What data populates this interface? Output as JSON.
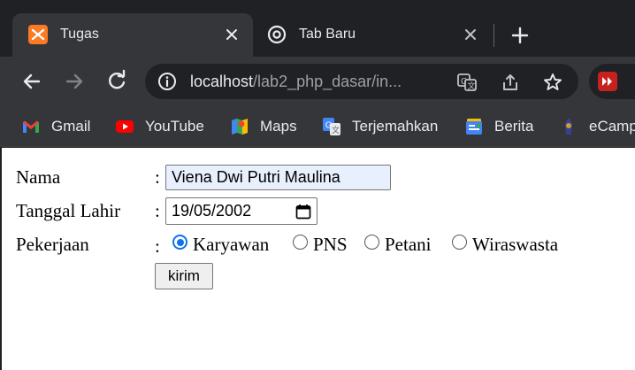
{
  "tabs": [
    {
      "title": "Tugas",
      "active": true,
      "icon": "xampp-icon"
    },
    {
      "title": "Tab Baru",
      "active": false,
      "icon": "chrome-icon"
    }
  ],
  "toolbar": {
    "url_host": "localhost",
    "url_path": "/lab2_php_dasar/in..."
  },
  "bookmarks": [
    {
      "label": "Gmail",
      "icon": "gmail-icon"
    },
    {
      "label": "YouTube",
      "icon": "youtube-icon"
    },
    {
      "label": "Maps",
      "icon": "maps-icon"
    },
    {
      "label": "Terjemahkan",
      "icon": "translate-icon"
    },
    {
      "label": "Berita",
      "icon": "news-icon"
    },
    {
      "label": "eCamp",
      "icon": "ecampus-icon"
    }
  ],
  "form": {
    "nama_label": "Nama",
    "nama_value": "Viena Dwi Putri Maulina",
    "tanggal_label": "Tanggal Lahir",
    "tanggal_value": "19/05/2002",
    "pekerjaan_label": "Pekerjaan",
    "colon": ":",
    "options": [
      {
        "label": "Karyawan",
        "checked": true
      },
      {
        "label": "PNS",
        "checked": false
      },
      {
        "label": "Petani",
        "checked": false
      },
      {
        "label": "Wiraswasta",
        "checked": false
      }
    ],
    "submit_label": "kirim"
  },
  "colors": {
    "frame_dark": "#202124",
    "toolbar": "#35363a",
    "radio_accent": "#0f73e8",
    "autofill_bg": "#e8f0fe"
  }
}
